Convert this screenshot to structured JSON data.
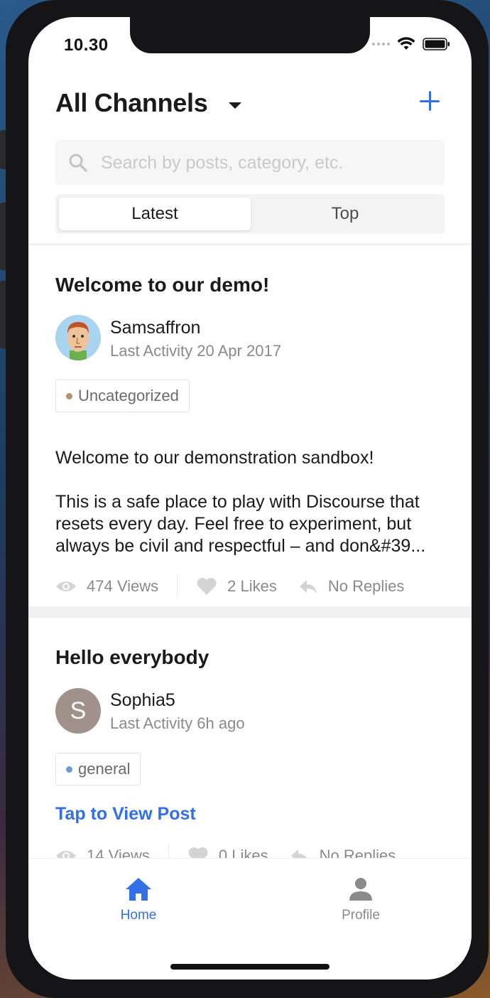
{
  "status_bar": {
    "time": "10.30"
  },
  "header": {
    "title": "All Channels"
  },
  "search": {
    "placeholder": "Search by posts, category, etc."
  },
  "segmented": {
    "tabs": [
      "Latest",
      "Top"
    ],
    "active": "Latest"
  },
  "posts": [
    {
      "title": "Welcome to our demo!",
      "author": "Samsaffron",
      "activity": "Last Activity 20 Apr 2017",
      "category": "Uncategorized",
      "category_color": "#b3946b",
      "excerpt_line1": "Welcome to our demonstration sandbox!",
      "excerpt_line2": "This is a safe place to play with Discourse that resets every day. Feel free to experiment, but always be civil and respectful – and don&#39...",
      "views": "474 Views",
      "likes": "2 Likes",
      "replies": "No Replies"
    },
    {
      "title": "Hello everybody",
      "author": "Sophia5",
      "avatar_letter": "S",
      "avatar_color": "#a0928a",
      "activity": "Last Activity 6h ago",
      "category": "general",
      "category_color": "#6b9bd1",
      "cta": "Tap to View Post",
      "views": "14 Views",
      "likes": "0 Likes",
      "replies": "No Replies"
    }
  ],
  "tab_bar": {
    "items": [
      {
        "label": "Home",
        "icon": "home-icon",
        "active": true
      },
      {
        "label": "Profile",
        "icon": "person-icon",
        "active": false
      }
    ]
  },
  "colors": {
    "accent": "#3370e8",
    "muted": "#8a8a8a",
    "text": "#1a1a1a"
  }
}
